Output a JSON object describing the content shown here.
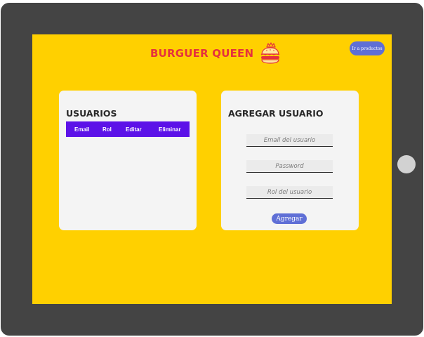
{
  "header": {
    "logo_text": "BURGUER QUEEN",
    "logo_icon": "burger-crown-icon",
    "goto_products_label": "Ir a productos"
  },
  "users_panel": {
    "title": "USUARIOS",
    "columns": [
      "Email",
      "Rol",
      "Editar",
      "Eliminar"
    ]
  },
  "add_user_panel": {
    "title": "AGREGAR USUARIO",
    "email_placeholder": "Email del usuario",
    "password_placeholder": "Password",
    "role_placeholder": "Rol del usuario",
    "submit_label": "Agregar"
  },
  "colors": {
    "background": "#ffd000",
    "logo": "#e5313d",
    "table_header": "#5c12e8",
    "button": "#5f6fd6",
    "card": "#f4f4f4",
    "device_frame": "#444444"
  }
}
